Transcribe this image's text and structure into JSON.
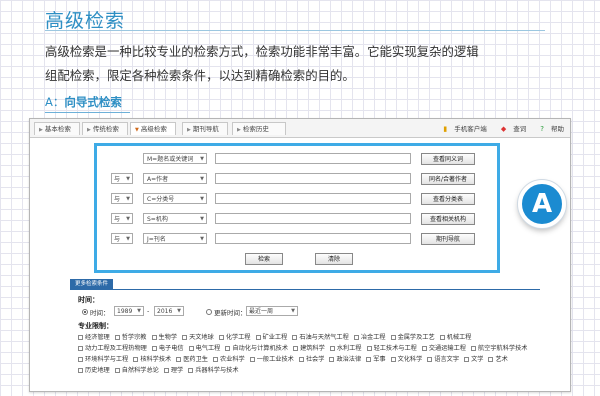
{
  "heading": "高级检索",
  "description_line1": "高级检索是一种比较专业的检索方式，检索功能非常丰富。它能实现复杂的逻辑",
  "description_line2": "组配检索，限定各种检索条件，以达到精确检索的目的。",
  "subheading_prefix": "A：",
  "subheading_text": "向导式检索",
  "tabs": [
    "基本检索",
    "传统检索",
    "高级检索",
    "期刊导航",
    "检索历史"
  ],
  "active_tab": "高级检索",
  "tools": {
    "mobile": "手机客户端",
    "query": "查词",
    "help": "帮助"
  },
  "search_rows": [
    {
      "operator": "",
      "field": "M=题名或关键词",
      "button": "查看同义词"
    },
    {
      "operator": "与",
      "field": "A=作者",
      "button": "同名/合著作者"
    },
    {
      "operator": "与",
      "field": "C=分类号",
      "button": "查看分类表"
    },
    {
      "operator": "与",
      "field": "S=机构",
      "button": "查看相关机构"
    },
    {
      "operator": "与",
      "field": "J=刊名",
      "button": "期刊导航"
    }
  ],
  "search_button": "检索",
  "clear_button": "清除",
  "badge_label": "A",
  "more_conditions_tab": "更多检索条件",
  "time_label": "时间：",
  "time_option": "时间：",
  "year_from": "1989",
  "year_to": "2016",
  "update_option": "更新时间：",
  "update_value": "最近一周",
  "subject_label": "专业限制：",
  "subjects": [
    "经济管理",
    "哲学宗教",
    "生物学",
    "天文地球",
    "化学工程",
    "矿业工程",
    "石油与天然气工程",
    "冶金工程",
    "金属学及工艺",
    "机械工程",
    "动力工程及工程热物理",
    "电子电信",
    "电气工程",
    "自动化与计算机技术",
    "建筑科学",
    "水利工程",
    "轻工技术与工程",
    "交通运输工程",
    "航空宇航科学技术",
    "环境科学与工程",
    "核科学技术",
    "医药卫生",
    "农业科学",
    "一般工业技术",
    "社会学",
    "政治法律",
    "军事",
    "文化科学",
    "语言文字",
    "文学",
    "艺术",
    "历史地理",
    "自然科学总论",
    "理学",
    "兵器科学与技术"
  ]
}
